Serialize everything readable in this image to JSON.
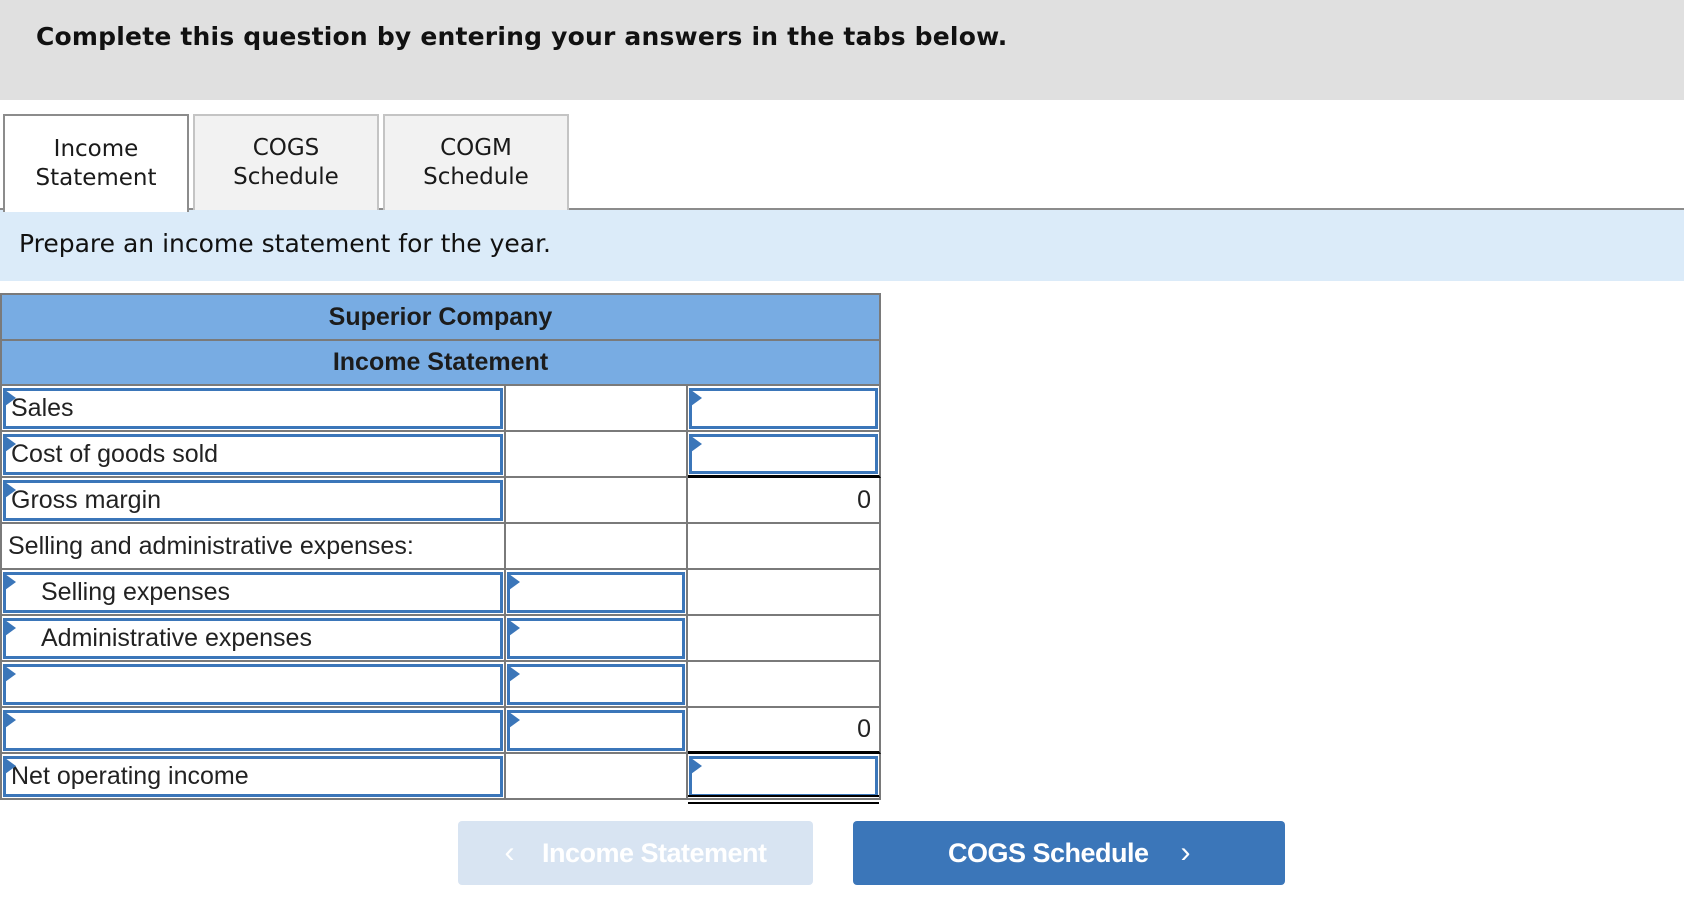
{
  "header": {
    "instruction": "Complete this question by entering your answers in the tabs below."
  },
  "tabs": [
    {
      "label": "Income\nStatement",
      "active": true
    },
    {
      "label": "COGS\nSchedule",
      "active": false
    },
    {
      "label": "COGM\nSchedule",
      "active": false
    }
  ],
  "prompt": "Prepare an income statement for the year.",
  "statement": {
    "company": "Superior Company",
    "title": "Income Statement",
    "rows": [
      {
        "label": "Sales",
        "col2": "",
        "col3": ""
      },
      {
        "label": "Cost of goods sold",
        "col2": "",
        "col3": ""
      },
      {
        "label": "Gross margin",
        "col2": "",
        "col3": "0"
      },
      {
        "label": "Selling and administrative expenses:",
        "col2": "",
        "col3": ""
      },
      {
        "label": "Selling expenses",
        "col2": "",
        "col3": ""
      },
      {
        "label": "Administrative expenses",
        "col2": "",
        "col3": ""
      },
      {
        "label": "",
        "col2": "",
        "col3": ""
      },
      {
        "label": "",
        "col2": "",
        "col3": "0"
      },
      {
        "label": "Net operating income",
        "col2": "",
        "col3": ""
      }
    ]
  },
  "navigation": {
    "prev_label": "Income Statement",
    "next_label": "COGS Schedule",
    "prev_icon": "chevron-left-icon",
    "next_icon": "chevron-right-icon",
    "prev_glyph": "‹",
    "next_glyph": "›"
  },
  "colors": {
    "header_bg": "#e0e0e0",
    "prompt_bg": "#dbebf9",
    "table_header_bg": "#78ace3",
    "input_border": "#3b76b9",
    "next_button_bg": "#3b76b9",
    "prev_button_bg": "#d8e4f2"
  }
}
